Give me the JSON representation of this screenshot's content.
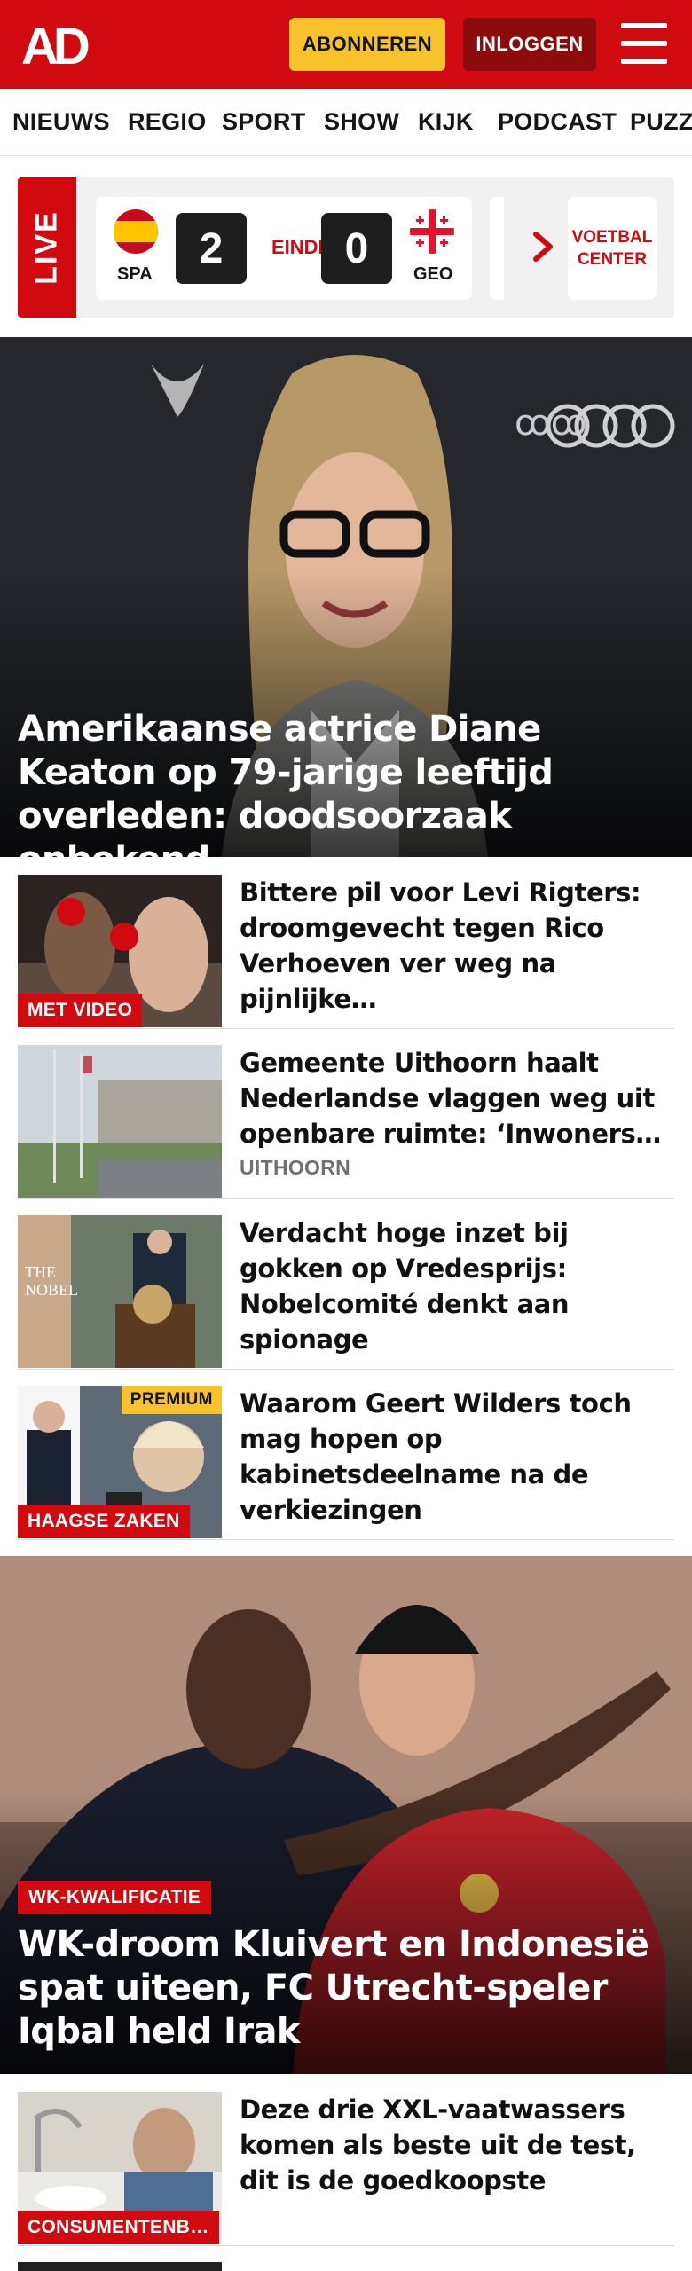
{
  "header": {
    "logo_text": "AD",
    "subscribe_label": "ABONNEREN",
    "login_label": "INLOGGEN"
  },
  "nav": {
    "items": [
      "NIEUWS",
      "REGIO",
      "SPORT",
      "SHOW",
      "KIJK",
      "PODCAST",
      "PUZZ"
    ]
  },
  "live": {
    "badge": "LIVE",
    "home_code": "SPA",
    "away_code": "GEO",
    "home_score": "2",
    "away_score": "0",
    "status": "EINDE",
    "center_label_line1": "VOETBAL",
    "center_label_line2": "CENTER"
  },
  "hero1": {
    "title": "Amerikaanse actrice Diane Keaton op 79-jarige leeftijd overleden: doodsoorzaak onbekend"
  },
  "articles": [
    {
      "title": "Bittere pil voor Levi Rigters: droomgevecht tegen Rico Verhoeven ver weg na pijnlijke…",
      "tag": "MET VIDEO"
    },
    {
      "title": "Gemeente Uithoorn haalt Nederlandse vlaggen weg uit openbare ruimte: ‘Inwoners…",
      "category": "UITHOORN"
    },
    {
      "title": "Verdacht hoge inzet bij gokken op Vredesprijs: Nobelcomité denkt aan spionage"
    },
    {
      "title": "Waarom Geert Wilders toch mag hopen op kabinetsdeelname na de verkiezingen",
      "tag": "HAAGSE ZAKEN",
      "premium": "PREMIUM"
    }
  ],
  "hero2": {
    "tag": "WK-KWALIFICATIE",
    "title": "WK-droom Kluivert en Indonesië spat uiteen, FC Utrecht-speler Iqbal held Irak"
  },
  "articles2": [
    {
      "title": "Deze drie XXL-vaatwassers komen als beste uit de test, dit is de goedkoopste",
      "tag": "CONSUMENTENB…"
    }
  ],
  "colors": {
    "brand_red": "#d10a10",
    "accent_yellow": "#f7c22b",
    "dark_red": "#8c0b0d"
  }
}
